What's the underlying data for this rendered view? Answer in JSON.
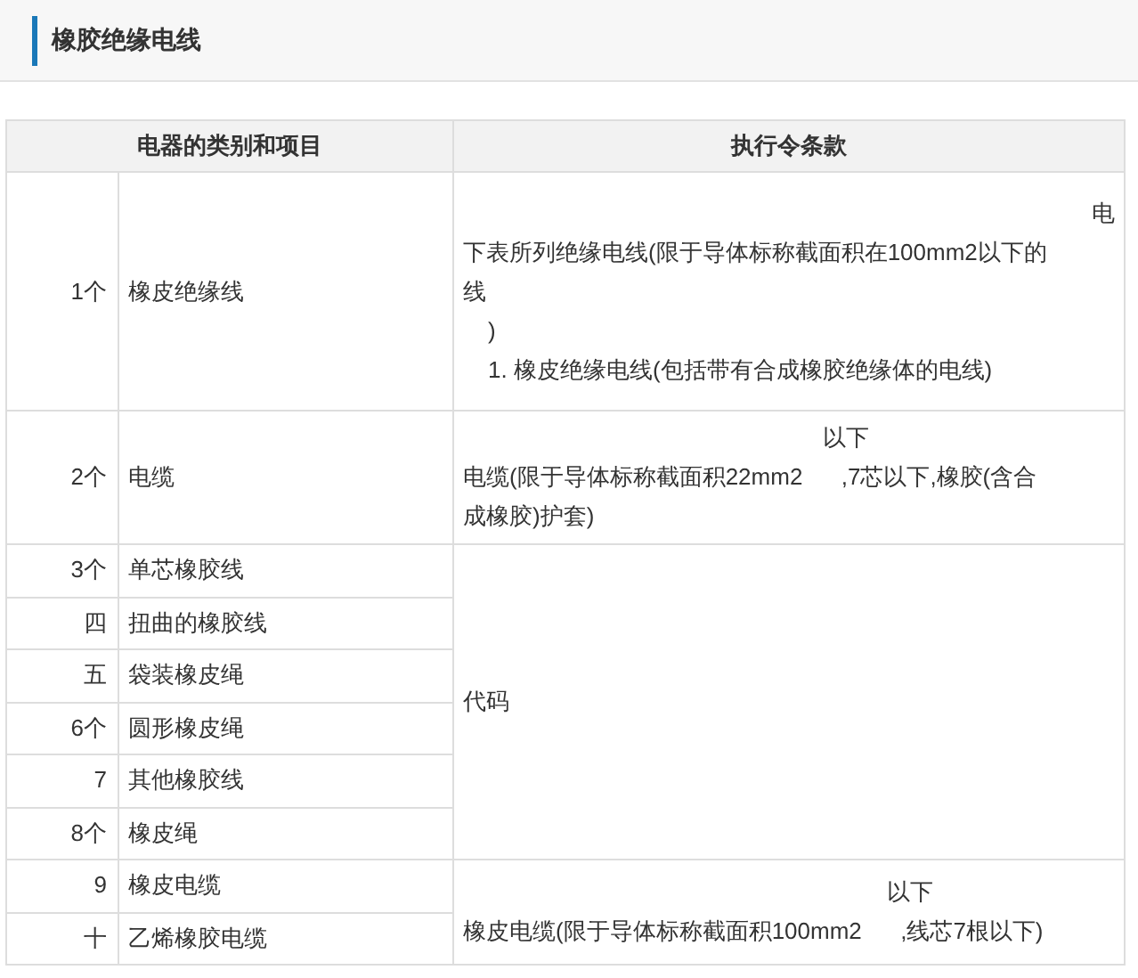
{
  "title": "橡胶绝缘电线",
  "table": {
    "columns": [
      "电器的类别和项目",
      "执行令条款"
    ],
    "groups": [
      {
        "items": [
          {
            "number": "1个",
            "item": "橡皮绝缘线"
          }
        ],
        "provision": [
          {
            "kind": "right",
            "text": "电"
          },
          {
            "kind": "line",
            "text": "下表所列绝缘电线(限于导体标称截面积在100mm2以下的"
          },
          {
            "kind": "line",
            "text": "线"
          },
          {
            "kind": "indent",
            "text": ")"
          },
          {
            "kind": "indent",
            "text": "1. 橡皮绝缘电线(包括带有合成橡胶绝缘体的电线)"
          }
        ]
      },
      {
        "items": [
          {
            "number": "2个",
            "item": "电缆"
          }
        ],
        "provision": [
          {
            "kind": "note",
            "text": "以下"
          },
          {
            "kind": "line",
            "text": "电缆(限于导体标称截面积22mm2      ,7芯以下,橡胶(含合"
          },
          {
            "kind": "line",
            "text": "成橡胶)护套)"
          }
        ]
      },
      {
        "items": [
          {
            "number": "3个",
            "item": "单芯橡胶线"
          },
          {
            "number": "四",
            "item": "扭曲的橡胶线"
          },
          {
            "number": "五",
            "item": "袋装橡皮绳"
          },
          {
            "number": "6个",
            "item": "圆形橡皮绳"
          },
          {
            "number": "7",
            "item": "其他橡胶线"
          },
          {
            "number": "8个",
            "item": "橡皮绳"
          }
        ],
        "provision": [
          {
            "kind": "line",
            "text": "代码"
          }
        ]
      },
      {
        "items": [
          {
            "number": "9",
            "item": "橡皮电缆"
          },
          {
            "number": "十",
            "item": "乙烯橡胶电缆"
          }
        ],
        "provision": [
          {
            "kind": "note",
            "text": "以下"
          },
          {
            "kind": "line",
            "text": "橡皮电缆(限于导体标称截面积100mm2      ,线芯7根以下)"
          }
        ]
      }
    ]
  }
}
